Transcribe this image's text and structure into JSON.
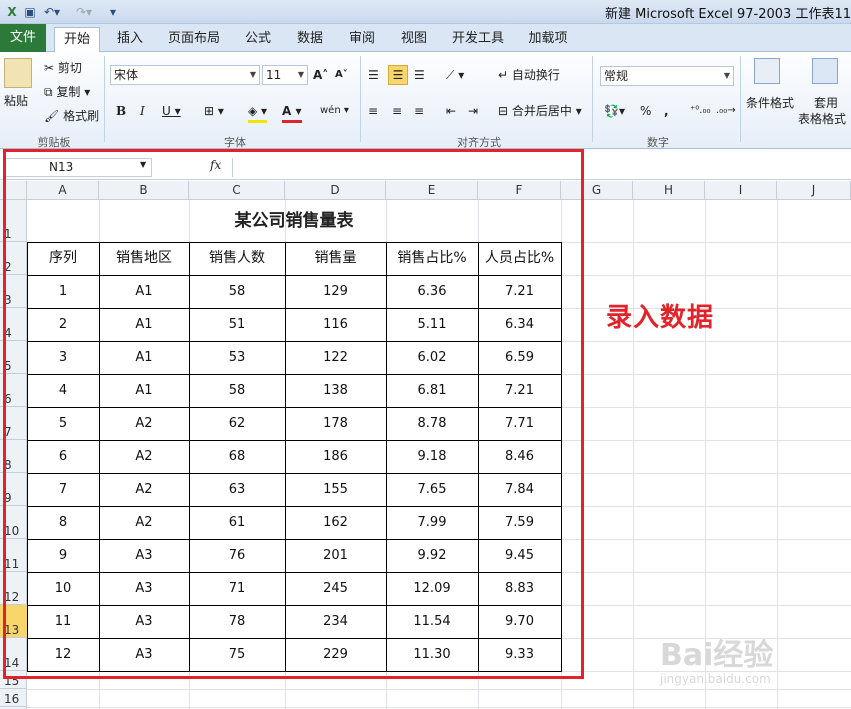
{
  "window": {
    "title": "新建 Microsoft Excel 97-2003 工作表11"
  },
  "ribbon_tabs": [
    "文件",
    "开始",
    "插入",
    "页面布局",
    "公式",
    "数据",
    "审阅",
    "视图",
    "开发工具",
    "加载项"
  ],
  "clipboard": {
    "paste": "粘贴",
    "cut": "剪切",
    "copy": "复制",
    "format_painter": "格式刷",
    "group": "剪贴板"
  },
  "font": {
    "name": "宋体",
    "size": "11",
    "group": "字体"
  },
  "alignment": {
    "wrap": "自动换行",
    "merge": "合并后居中",
    "group": "对齐方式"
  },
  "number": {
    "format": "常规",
    "group": "数字"
  },
  "styles": {
    "conditional": "条件格式",
    "table_line1": "套用",
    "table_line2": "表格格式"
  },
  "formula_bar": {
    "name_box": "N13",
    "fx": "fx",
    "value": ""
  },
  "columns": [
    "A",
    "B",
    "C",
    "D",
    "E",
    "F",
    "G",
    "H",
    "I",
    "J"
  ],
  "rows": [
    "1",
    "2",
    "3",
    "4",
    "5",
    "6",
    "7",
    "8",
    "9",
    "10",
    "11",
    "12",
    "13",
    "14",
    "15",
    "16"
  ],
  "selected_row": "13",
  "sheet": {
    "title": "某公司销售量表",
    "headers": [
      "序列",
      "销售地区",
      "销售人数",
      "销售量",
      "销售占比%",
      "人员占比%"
    ],
    "rows": [
      [
        "1",
        "A1",
        "58",
        "129",
        "6.36",
        "7.21"
      ],
      [
        "2",
        "A1",
        "51",
        "116",
        "5.11",
        "6.34"
      ],
      [
        "3",
        "A1",
        "53",
        "122",
        "6.02",
        "6.59"
      ],
      [
        "4",
        "A1",
        "58",
        "138",
        "6.81",
        "7.21"
      ],
      [
        "5",
        "A2",
        "62",
        "178",
        "8.78",
        "7.71"
      ],
      [
        "6",
        "A2",
        "68",
        "186",
        "9.18",
        "8.46"
      ],
      [
        "7",
        "A2",
        "63",
        "155",
        "7.65",
        "7.84"
      ],
      [
        "8",
        "A2",
        "61",
        "162",
        "7.99",
        "7.59"
      ],
      [
        "9",
        "A3",
        "76",
        "201",
        "9.92",
        "9.45"
      ],
      [
        "10",
        "A3",
        "71",
        "245",
        "12.09",
        "8.83"
      ],
      [
        "11",
        "A3",
        "78",
        "234",
        "11.54",
        "9.70"
      ],
      [
        "12",
        "A3",
        "75",
        "229",
        "11.30",
        "9.33"
      ]
    ]
  },
  "annotation": "录入数据",
  "watermark": {
    "brand": "Bai经验",
    "url": "jingyan.baidu.com"
  },
  "colors": {
    "accent_red": "#e2232a",
    "file_tab": "#2c7a3a"
  }
}
